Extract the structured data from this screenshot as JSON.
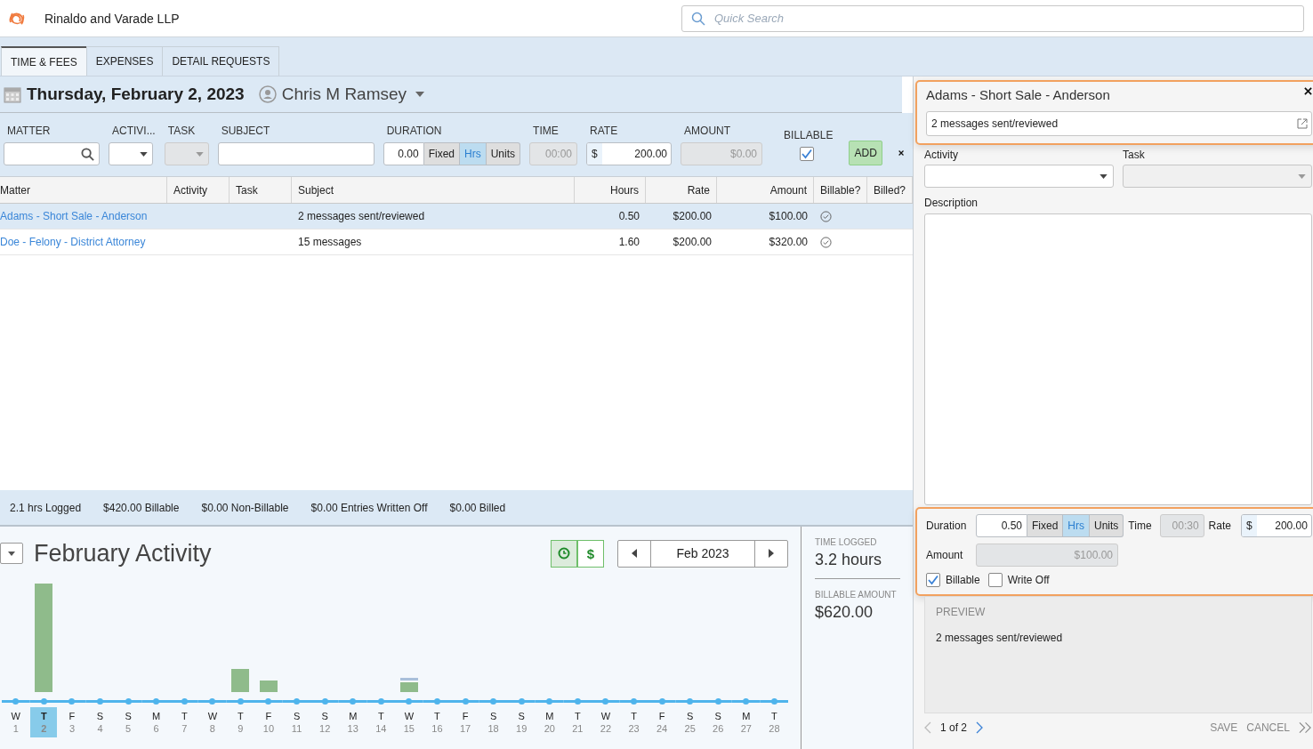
{
  "app": {
    "firm": "Rinaldo and Varade LLP",
    "search_placeholder": "Quick Search"
  },
  "tabs": [
    {
      "label": "TIME & FEES",
      "selected": true
    },
    {
      "label": "EXPENSES",
      "selected": false
    },
    {
      "label": "DETAIL REQUESTS",
      "selected": false
    }
  ],
  "header": {
    "date": "Thursday, February 2, 2023",
    "user": "Chris M Ramsey"
  },
  "entry_form": {
    "matter_label": "MATTER",
    "activity_label": "ACTIVI...",
    "task_label": "TASK",
    "task_disabled": true,
    "subject_label": "SUBJECT",
    "duration_label": "DURATION",
    "duration": "0.00",
    "units": [
      {
        "label": "Fixed",
        "selected": false
      },
      {
        "label": "Hrs",
        "selected": true
      },
      {
        "label": "Units",
        "selected": false
      }
    ],
    "time_label": "TIME",
    "time": "00:00",
    "rate_label": "RATE",
    "currency": "$",
    "rate": "200.00",
    "amount_label": "AMOUNT",
    "amount": "$0.00",
    "billable_label": "BILLABLE",
    "billable": true,
    "add": "ADD"
  },
  "table": {
    "columns": [
      "Matter",
      "Activity",
      "Task",
      "Subject",
      "Hours",
      "Rate",
      "Amount",
      "Billable?",
      "Billed?"
    ],
    "rows": [
      {
        "matter": "Adams - Short Sale - Anderson",
        "subject": "2 messages sent/reviewed",
        "hours": "0.50",
        "rate": "$200.00",
        "amount": "$100.00",
        "billable": true,
        "billed": false,
        "selected": true
      },
      {
        "matter": "Doe - Felony - District Attorney",
        "subject": "15 messages",
        "hours": "1.60",
        "rate": "$200.00",
        "amount": "$320.00",
        "billable": true,
        "billed": false,
        "selected": false
      }
    ]
  },
  "summary": [
    "2.1 hrs Logged",
    "$420.00 Billable",
    "$0.00 Non-Billable",
    "$0.00 Entries Written Off",
    "$0.00 Billed"
  ],
  "activity": {
    "title": "February Activity",
    "toggles": [
      {
        "kind": "time",
        "selected": true
      },
      {
        "kind": "money",
        "label": "$",
        "selected": false
      }
    ],
    "month": "Feb 2023",
    "days": [
      {
        "day": "W",
        "date": "1",
        "selected": false
      },
      {
        "day": "T",
        "date": "2",
        "selected": true
      },
      {
        "day": "F",
        "date": "3",
        "selected": false
      },
      {
        "day": "S",
        "date": "4",
        "selected": false
      },
      {
        "day": "S",
        "date": "5",
        "selected": false
      },
      {
        "day": "M",
        "date": "6",
        "selected": false
      },
      {
        "day": "T",
        "date": "7",
        "selected": false
      },
      {
        "day": "W",
        "date": "8",
        "selected": false
      },
      {
        "day": "T",
        "date": "9",
        "selected": false
      },
      {
        "day": "F",
        "date": "10",
        "selected": false
      },
      {
        "day": "S",
        "date": "11",
        "selected": false
      },
      {
        "day": "S",
        "date": "12",
        "selected": false
      },
      {
        "day": "M",
        "date": "13",
        "selected": false
      },
      {
        "day": "T",
        "date": "14",
        "selected": false
      },
      {
        "day": "W",
        "date": "15",
        "selected": false
      },
      {
        "day": "T",
        "date": "16",
        "selected": false
      },
      {
        "day": "F",
        "date": "17",
        "selected": false
      },
      {
        "day": "S",
        "date": "18",
        "selected": false
      },
      {
        "day": "S",
        "date": "19",
        "selected": false
      },
      {
        "day": "M",
        "date": "20",
        "selected": false
      },
      {
        "day": "T",
        "date": "21",
        "selected": false
      },
      {
        "day": "W",
        "date": "22",
        "selected": false
      },
      {
        "day": "T",
        "date": "23",
        "selected": false
      },
      {
        "day": "F",
        "date": "24",
        "selected": false
      },
      {
        "day": "S",
        "date": "25",
        "selected": false
      },
      {
        "day": "S",
        "date": "26",
        "selected": false
      },
      {
        "day": "M",
        "date": "27",
        "selected": false
      },
      {
        "day": "T",
        "date": "28",
        "selected": false
      }
    ],
    "stats": [
      {
        "label": "TIME LOGGED",
        "value": "3.2 hours"
      },
      {
        "label": "BILLABLE AMOUNT",
        "value": "$620.00"
      }
    ]
  },
  "detail": {
    "title": "Adams - Short Sale - Anderson",
    "subject": "2 messages sent/reviewed",
    "highlighted": true,
    "activity_label": "Activity",
    "task_label": "Task",
    "task_disabled": true,
    "description_label": "Description",
    "duration_label": "Duration",
    "duration": "0.50",
    "units": [
      {
        "label": "Fixed",
        "selected": false
      },
      {
        "label": "Hrs",
        "selected": true
      },
      {
        "label": "Units",
        "selected": false
      }
    ],
    "time_label": "Time",
    "time": "00:30",
    "rate_label": "Rate",
    "currency": "$",
    "rate": "200.00",
    "amount_label": "Amount",
    "amount": "$100.00",
    "values_highlighted": true,
    "checks": [
      {
        "label": "Billable",
        "checked": true
      },
      {
        "label": "Write Off",
        "checked": false
      }
    ],
    "preview_label": "PREVIEW",
    "preview": "2 messages sent/reviewed",
    "pager": "1 of 2",
    "save": "SAVE",
    "cancel": "CANCEL"
  }
}
